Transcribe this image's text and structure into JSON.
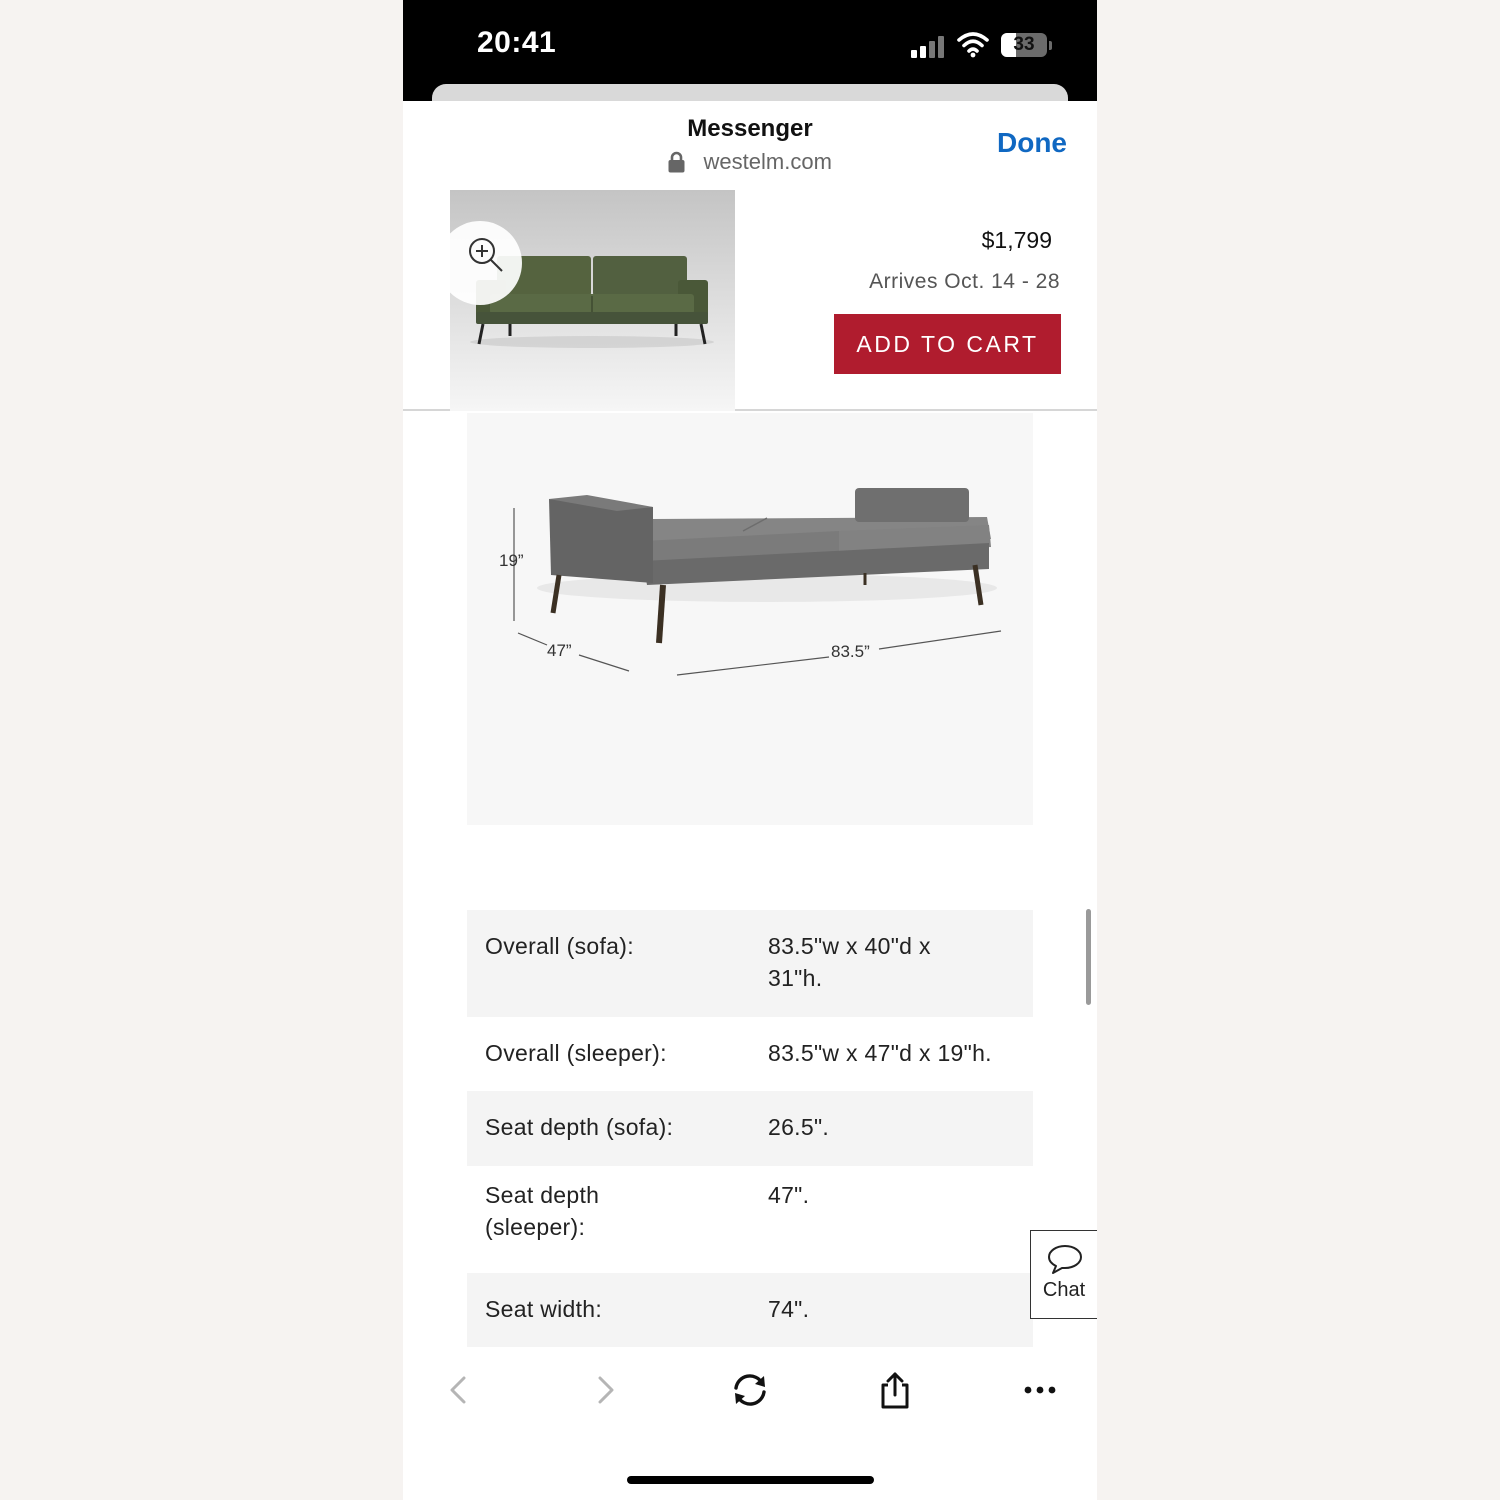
{
  "status_bar": {
    "time": "20:41",
    "battery_level": "33",
    "battery_fraction": 0.33,
    "icons": [
      "cellular-signal-icon",
      "wifi-icon",
      "battery-icon"
    ]
  },
  "sheet": {
    "title": "Messenger",
    "url": "westelm.com",
    "done_label": "Done",
    "lock_icon": "lock-icon"
  },
  "product": {
    "price": "$1,799",
    "arrives": "Arrives Oct. 14 - 28",
    "add_to_cart_label": "ADD TO CART",
    "zoom_icon": "zoom-in-icon"
  },
  "dimensions_image": {
    "height_label": "19”",
    "depth_label": "47”",
    "width_label": "83.5”"
  },
  "specs": [
    {
      "label": "Overall (sofa):",
      "value": "83.5\"w x 40\"d x 31\"h."
    },
    {
      "label": "Overall (sleeper):",
      "value": "83.5\"w x 47\"d x 19\"h."
    },
    {
      "label": "Seat depth (sofa):",
      "value": "26.5\"."
    },
    {
      "label": "Seat depth (sleeper):",
      "value": "47\"."
    },
    {
      "label": "Seat width:",
      "value": "74\"."
    }
  ],
  "chat": {
    "label": "Chat",
    "icon": "speech-bubble-icon"
  },
  "toolbar": {
    "icons": [
      "back-icon",
      "forward-icon",
      "reload-icon",
      "share-icon",
      "more-icon"
    ]
  },
  "colors": {
    "accent_blue": "#1068c2",
    "cart_red": "#b01c2e",
    "sofa_green": "#4f5e3e",
    "sofa_gray": "#6e6e6e"
  }
}
